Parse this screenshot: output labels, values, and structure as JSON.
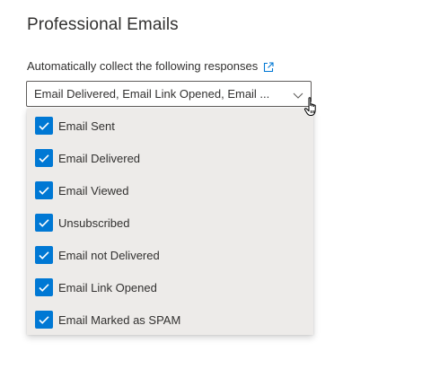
{
  "section": {
    "title": "Professional Emails"
  },
  "field": {
    "label": "Automatically collect the following responses",
    "label_icon": "open-in-new-window-icon",
    "selected_value": "Email Delivered, Email Link Opened, Email ...",
    "dropdown_icon": "chevron-down-icon"
  },
  "options": [
    {
      "label": "Email Sent",
      "checked": true
    },
    {
      "label": "Email Delivered",
      "checked": true
    },
    {
      "label": "Email Viewed",
      "checked": true
    },
    {
      "label": "Unsubscribed",
      "checked": true
    },
    {
      "label": "Email not Delivered",
      "checked": true
    },
    {
      "label": "Email Link Opened",
      "checked": true
    },
    {
      "label": "Email Marked as SPAM",
      "checked": true
    }
  ],
  "colors": {
    "accent": "#0078d4",
    "menu_background": "#edebe9",
    "text": "#323130"
  },
  "cursor": "hand-pointer-icon"
}
